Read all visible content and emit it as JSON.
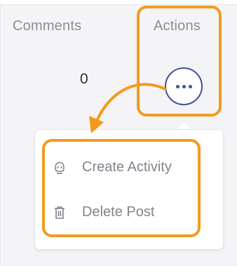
{
  "table": {
    "comments_header": "Comments",
    "actions_header": "Actions",
    "comment_count": "0"
  },
  "actions_button": {
    "icon": "more-horizontal-icon"
  },
  "menu": {
    "items": [
      {
        "label": "Create Activity",
        "icon": "activity-icon"
      },
      {
        "label": "Delete Post",
        "icon": "trash-icon"
      }
    ]
  },
  "colors": {
    "highlight": "#f39a1e",
    "button_border": "#3f4fa0",
    "menu_text": "#80838c",
    "header_text": "#8a8d96"
  }
}
